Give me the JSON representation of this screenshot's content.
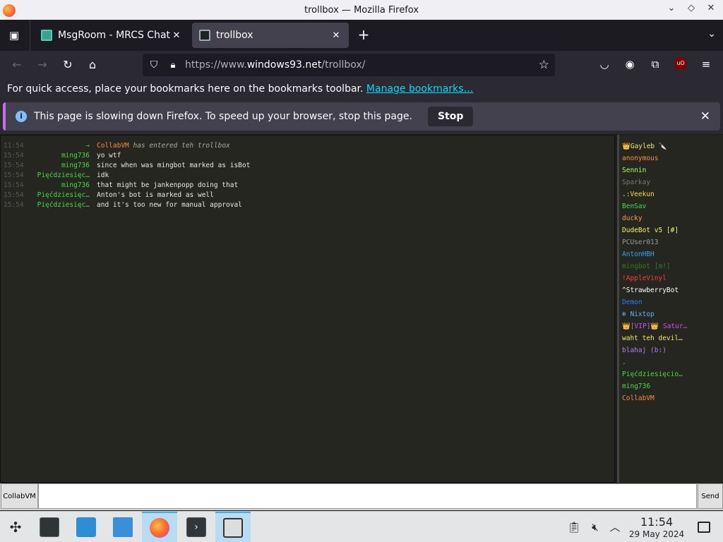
{
  "window": {
    "title": "trollbox — Mozilla Firefox"
  },
  "tabs": [
    {
      "label": "MsgRoom - MRCS Chat"
    },
    {
      "label": "trollbox"
    }
  ],
  "urlbar": {
    "url_prefix": "https://www.",
    "url_host": "windows93.net",
    "url_path": "/trollbox/"
  },
  "bookmarks": {
    "text": "For quick access, place your bookmarks here on the bookmarks toolbar.",
    "link": "Manage bookmarks…"
  },
  "notification": {
    "message": "This page is slowing down Firefox. To speed up your browser, stop this page.",
    "button": "Stop"
  },
  "chat": {
    "messages": [
      {
        "time": "11:54",
        "nick": "→",
        "nick_color": "#2ecc40",
        "text_who": "CollabVM",
        "text_rest": " has entered teh trollbox",
        "system": true
      },
      {
        "time": "15:54",
        "nick": "ming736",
        "nick_color": "#44dd44",
        "text": "yo wtf"
      },
      {
        "time": "15:54",
        "nick": "ming736",
        "nick_color": "#44dd44",
        "text": "since when was mingbot marked as isBot"
      },
      {
        "time": "15:54",
        "nick": "Pięćdziesięc…",
        "nick_color": "#44dd44",
        "text": "idk"
      },
      {
        "time": "15:54",
        "nick": "ming736",
        "nick_color": "#44dd44",
        "text": "that might be jankenpopp doing that"
      },
      {
        "time": "15:54",
        "nick": "Pięćdziesięc…",
        "nick_color": "#44dd44",
        "text": "Anton's bot is marked as well"
      },
      {
        "time": "15:54",
        "nick": "Pięćdziesięc…",
        "nick_color": "#44dd44",
        "text": "and it's too new for manual approval"
      }
    ]
  },
  "users": [
    {
      "name": "👑Gayleb 🔪",
      "color": "#f5e66b"
    },
    {
      "name": "anonymous",
      "color": "#ff8a3d"
    },
    {
      "name": "Sennin",
      "color": "#a8ff60"
    },
    {
      "name": "Sparkay",
      "color": "#777777"
    },
    {
      "name": ".:Veekun",
      "color": "#ffd84a"
    },
    {
      "name": "BenSav",
      "color": "#44dd44"
    },
    {
      "name": "ducky",
      "color": "#ff9e57"
    },
    {
      "name": "DudeBot v5 [#]",
      "color": "#f5f56b"
    },
    {
      "name": "PCUser013",
      "color": "#9a9a9a"
    },
    {
      "name": "AntonHBH",
      "color": "#3aa0ff"
    },
    {
      "name": "mingbot [m!]",
      "color": "#2f7a2f"
    },
    {
      "name": "!AppleVinyl",
      "color": "#ff3d3d"
    },
    {
      "name": "^StrawberryBot",
      "color": "#ffffff"
    },
    {
      "name": "Demon",
      "color": "#2f7bff"
    },
    {
      "name": "❄ Nixtop",
      "color": "#5ab4ff"
    },
    {
      "name": "👑[VIP]👑 Satur…",
      "color": "#d050ff"
    },
    {
      "name": "waht teh devil…",
      "color": "#f5e66b"
    },
    {
      "name": "blahaj (b:)",
      "color": "#b07cff"
    },
    {
      "name": ".",
      "color": "#44dd44"
    },
    {
      "name": "Pięćdziesięcio…",
      "color": "#44dd44"
    },
    {
      "name": "ming736",
      "color": "#44dd44"
    },
    {
      "name": "CollabVM",
      "color": "#ff8a3d"
    }
  ],
  "input": {
    "nick_button": "CollabVM",
    "send_button": "Send",
    "value": ""
  },
  "taskbar": {
    "time": "11:54",
    "date": "29 May 2024"
  }
}
